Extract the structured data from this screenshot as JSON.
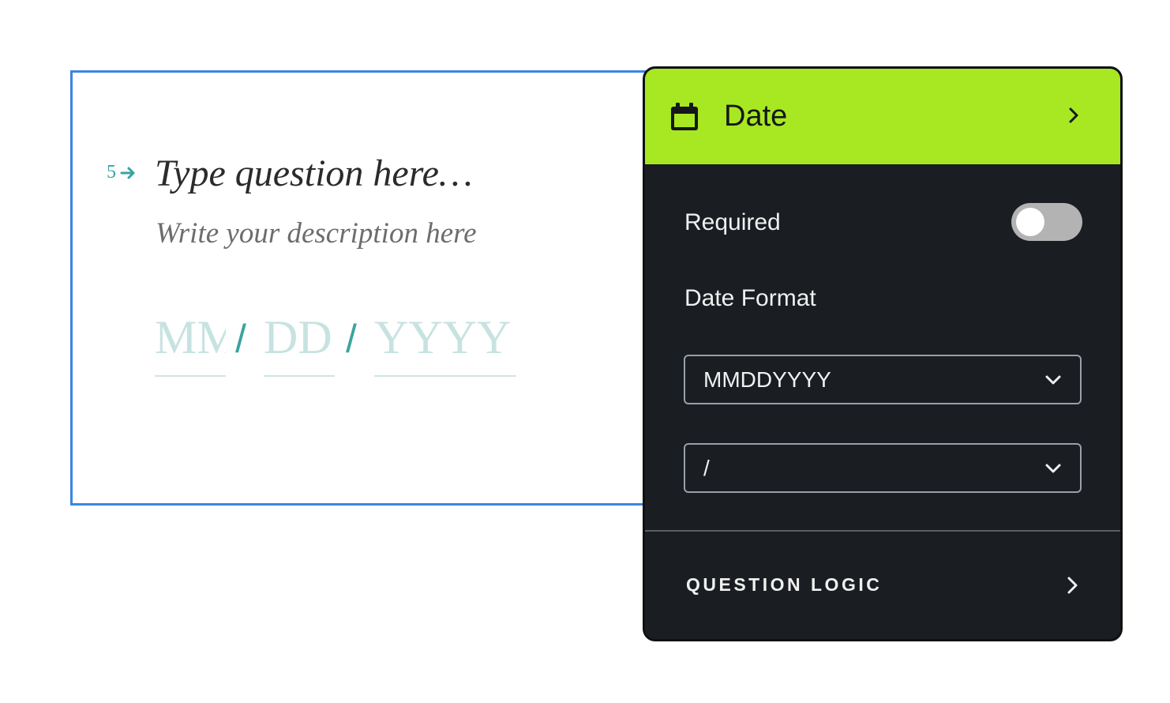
{
  "question": {
    "number": "5",
    "title": "Type question here…",
    "description": "Write your description here",
    "date_fields": {
      "month_placeholder": "MM",
      "day_placeholder": "DD",
      "year_placeholder": "YYYY",
      "separator": "/"
    }
  },
  "panel": {
    "title": "Date",
    "header_color": "#a8e822",
    "required_label": "Required",
    "required_enabled": false,
    "date_format_label": "Date Format",
    "date_format_value": "MMDDYYYY",
    "separator_value": "/",
    "question_logic_label": "QUESTION LOGIC"
  },
  "icons": {
    "question_arrow": "arrow-right-icon",
    "header": "calendar-icon",
    "header_chevron": "chevron-right-icon",
    "select_chevron": "chevron-down-icon",
    "logic_chevron": "chevron-right-icon"
  },
  "colors": {
    "card_border": "#3a86e0",
    "accent_teal": "#3aa39f",
    "panel_bg": "#1a1d22"
  }
}
